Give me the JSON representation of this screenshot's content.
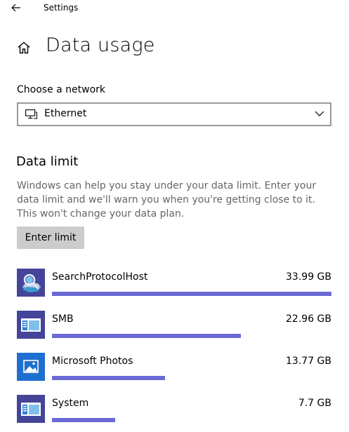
{
  "window": {
    "title": "Settings"
  },
  "header": {
    "title": "Data usage",
    "home_icon": "home-icon",
    "back_icon": "back-arrow-icon"
  },
  "network": {
    "label": "Choose a network",
    "selected": "Ethernet",
    "icon": "ethernet-monitor-icon"
  },
  "data_limit": {
    "title": "Data limit",
    "description": "Windows can help you stay under your data limit. Enter your data limit and we'll warn you when you're getting close to it. This won't change your data plan.",
    "button_label": "Enter limit"
  },
  "colors": {
    "accent": "#6b69d6",
    "button_bg": "#cccccc",
    "muted_text": "#666666"
  },
  "apps": [
    {
      "name": "SearchProtocolHost",
      "size": "33.99 GB",
      "usage_fraction": 1.0,
      "icon": "search-protocol-host-icon"
    },
    {
      "name": "SMB",
      "size": "22.96 GB",
      "usage_fraction": 0.675,
      "icon": "window-app-icon"
    },
    {
      "name": "Microsoft Photos",
      "size": "13.77 GB",
      "usage_fraction": 0.405,
      "icon": "photos-icon"
    },
    {
      "name": "System",
      "size": "7.7 GB",
      "usage_fraction": 0.226,
      "icon": "window-app-icon"
    }
  ]
}
